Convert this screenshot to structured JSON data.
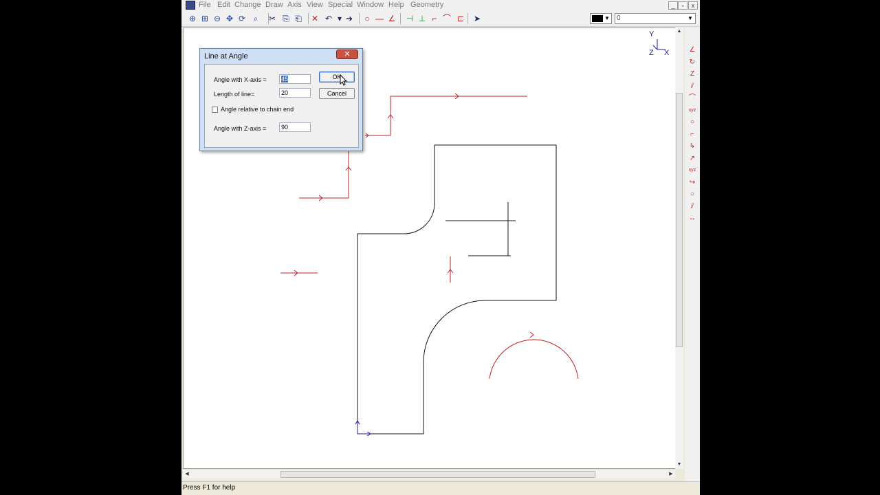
{
  "menu": [
    "File",
    "Edit",
    "Change",
    "Draw",
    "Axis",
    "View",
    "Special",
    "Window",
    "Help",
    "Geometry"
  ],
  "window_buttons": {
    "minimize": "_",
    "restore": "▫",
    "close": "x"
  },
  "toolbar": {
    "tools": [
      {
        "name": "zoom-in-icon",
        "glyph": "⊕",
        "color": "blue"
      },
      {
        "name": "zoom-window-icon",
        "glyph": "⊞",
        "color": "blue"
      },
      {
        "name": "zoom-out-icon",
        "glyph": "⊖",
        "color": "blue"
      },
      {
        "name": "pan-icon",
        "glyph": "✥",
        "color": "blue"
      },
      {
        "name": "redraw-icon",
        "glyph": "⟳",
        "color": "blue"
      },
      {
        "name": "zoom-fit-icon",
        "glyph": "⌕",
        "color": "blue"
      },
      {
        "name": "cut-icon",
        "glyph": "✂",
        "color": "navy"
      },
      {
        "name": "copy-icon",
        "glyph": "⎘",
        "color": "navy"
      },
      {
        "name": "paste-icon",
        "glyph": "⎗",
        "color": "navy"
      },
      {
        "name": "delete-icon",
        "glyph": "✕",
        "color": "red"
      },
      {
        "name": "undo-icon",
        "glyph": "↶",
        "color": "navy"
      },
      {
        "name": "undo-dropdown-icon",
        "glyph": "▾",
        "color": "navy"
      },
      {
        "name": "redo-icon",
        "glyph": "➜",
        "color": "navy"
      },
      {
        "name": "circle-icon",
        "glyph": "○",
        "color": "red"
      },
      {
        "name": "line-icon",
        "glyph": "—",
        "color": "red"
      },
      {
        "name": "angle-line-icon",
        "glyph": "∠",
        "color": "red"
      },
      {
        "name": "snap-1-icon",
        "glyph": "⊣",
        "color": "green"
      },
      {
        "name": "snap-2-icon",
        "glyph": "⊥",
        "color": "green"
      },
      {
        "name": "snap-3-icon",
        "glyph": "⌐",
        "color": "red"
      },
      {
        "name": "snap-4-icon",
        "glyph": "⌒",
        "color": "red"
      },
      {
        "name": "snap-5-icon",
        "glyph": "⊏",
        "color": "red"
      },
      {
        "name": "select-arrow-icon",
        "glyph": "➤",
        "color": "navy"
      }
    ],
    "color_value": "#000000",
    "layer_value": "0"
  },
  "sidebar_tools": [
    "∠",
    "↻",
    "Z",
    "⫽",
    "⌒",
    "xyz",
    "○",
    "⌐",
    "↳",
    "↗",
    "xyz",
    "↪",
    "○",
    "⫽",
    "↔"
  ],
  "axis_indicator": {
    "y": "Y",
    "z": "Z",
    "x": "X"
  },
  "dialog": {
    "title": "Line at Angle",
    "close_glyph": "✕",
    "angle_x_label": "Angle with X-axis =",
    "angle_x_value": "45",
    "length_label": "Length of line=",
    "length_value": "20",
    "relative_label": "Angle relative to chain end",
    "relative_checked": false,
    "angle_z_label": "Angle with Z-axis =",
    "angle_z_value": "90",
    "ok_label": "OK",
    "cancel_label": "Cancel"
  },
  "status": "Press F1 for help",
  "colors": {
    "entity_red": "#c02020",
    "entity_black": "#111111",
    "entity_blue": "#1a1a9a"
  }
}
